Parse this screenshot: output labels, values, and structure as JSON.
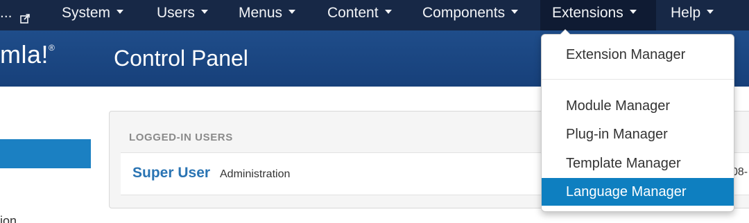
{
  "navbar": {
    "site_label": "...",
    "items": [
      {
        "label": "System"
      },
      {
        "label": "Users"
      },
      {
        "label": "Menus"
      },
      {
        "label": "Content"
      },
      {
        "label": "Components"
      },
      {
        "label": "Extensions"
      },
      {
        "label": "Help"
      }
    ],
    "active_item": "Extensions"
  },
  "header": {
    "logo_text": "mla!",
    "logo_mark": "®",
    "title": "Control Panel"
  },
  "sidebar": {
    "partial_text": "ion"
  },
  "logged_in_users": {
    "heading": "LOGGED-IN USERS",
    "rows": [
      {
        "user": "Super User",
        "role": "Administration",
        "date_fragment": "08-"
      }
    ]
  },
  "extensions_menu": {
    "items": [
      {
        "label": "Extension Manager"
      },
      {
        "label": "Module Manager"
      },
      {
        "label": "Plug-in Manager"
      },
      {
        "label": "Template Manager"
      },
      {
        "label": "Language Manager"
      }
    ],
    "highlighted_item": "Language Manager"
  },
  "colors": {
    "navbar": "#172846",
    "header": "#1f4d8a",
    "highlight": "#0e7fc0",
    "link": "#2a74b3"
  }
}
